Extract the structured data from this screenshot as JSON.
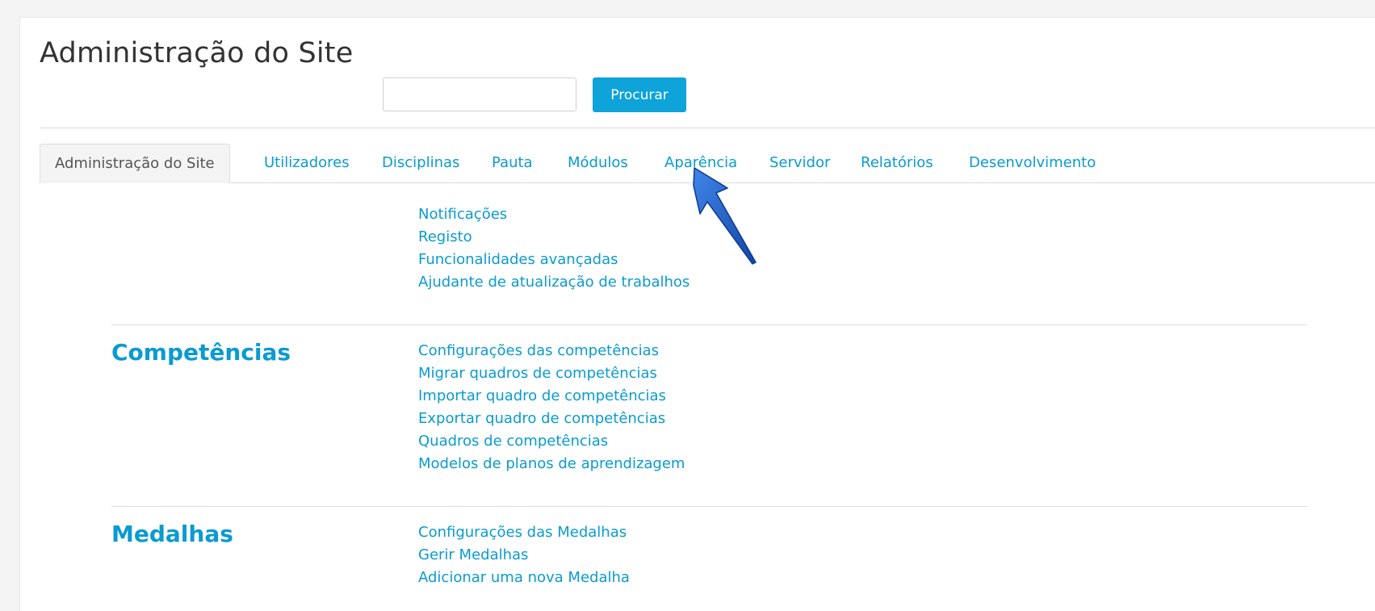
{
  "page": {
    "title": "Administração do Site"
  },
  "search": {
    "value": "",
    "placeholder": "",
    "button_label": "Procurar"
  },
  "tabs": [
    {
      "label": "Administração do Site",
      "active": true
    },
    {
      "label": "Utilizadores",
      "active": false
    },
    {
      "label": "Disciplinas",
      "active": false
    },
    {
      "label": "Pauta",
      "active": false
    },
    {
      "label": "Módulos",
      "active": false
    },
    {
      "label": "Aparência",
      "active": false
    },
    {
      "label": "Servidor",
      "active": false
    },
    {
      "label": "Relatórios",
      "active": false
    },
    {
      "label": "Desenvolvimento",
      "active": false
    }
  ],
  "sections": [
    {
      "heading": "",
      "links": [
        "Notificações",
        "Registo",
        "Funcionalidades avançadas",
        "Ajudante de atualização de trabalhos"
      ]
    },
    {
      "heading": "Competências",
      "links": [
        "Configurações das competências",
        "Migrar quadros de competências",
        "Importar quadro de competências",
        "Exportar quadro de competências",
        "Quadros de competências",
        "Modelos de planos de aprendizagem"
      ]
    },
    {
      "heading": "Medalhas",
      "links": [
        "Configurações das Medalhas",
        "Gerir Medalhas",
        "Adicionar uma nova Medalha"
      ]
    }
  ],
  "colors": {
    "link": "#0a9bd0",
    "button": "#0ea3d9",
    "annotation_arrow": "#1f5fc4"
  },
  "icons": {
    "annotation": "pointer-arrow-icon"
  }
}
